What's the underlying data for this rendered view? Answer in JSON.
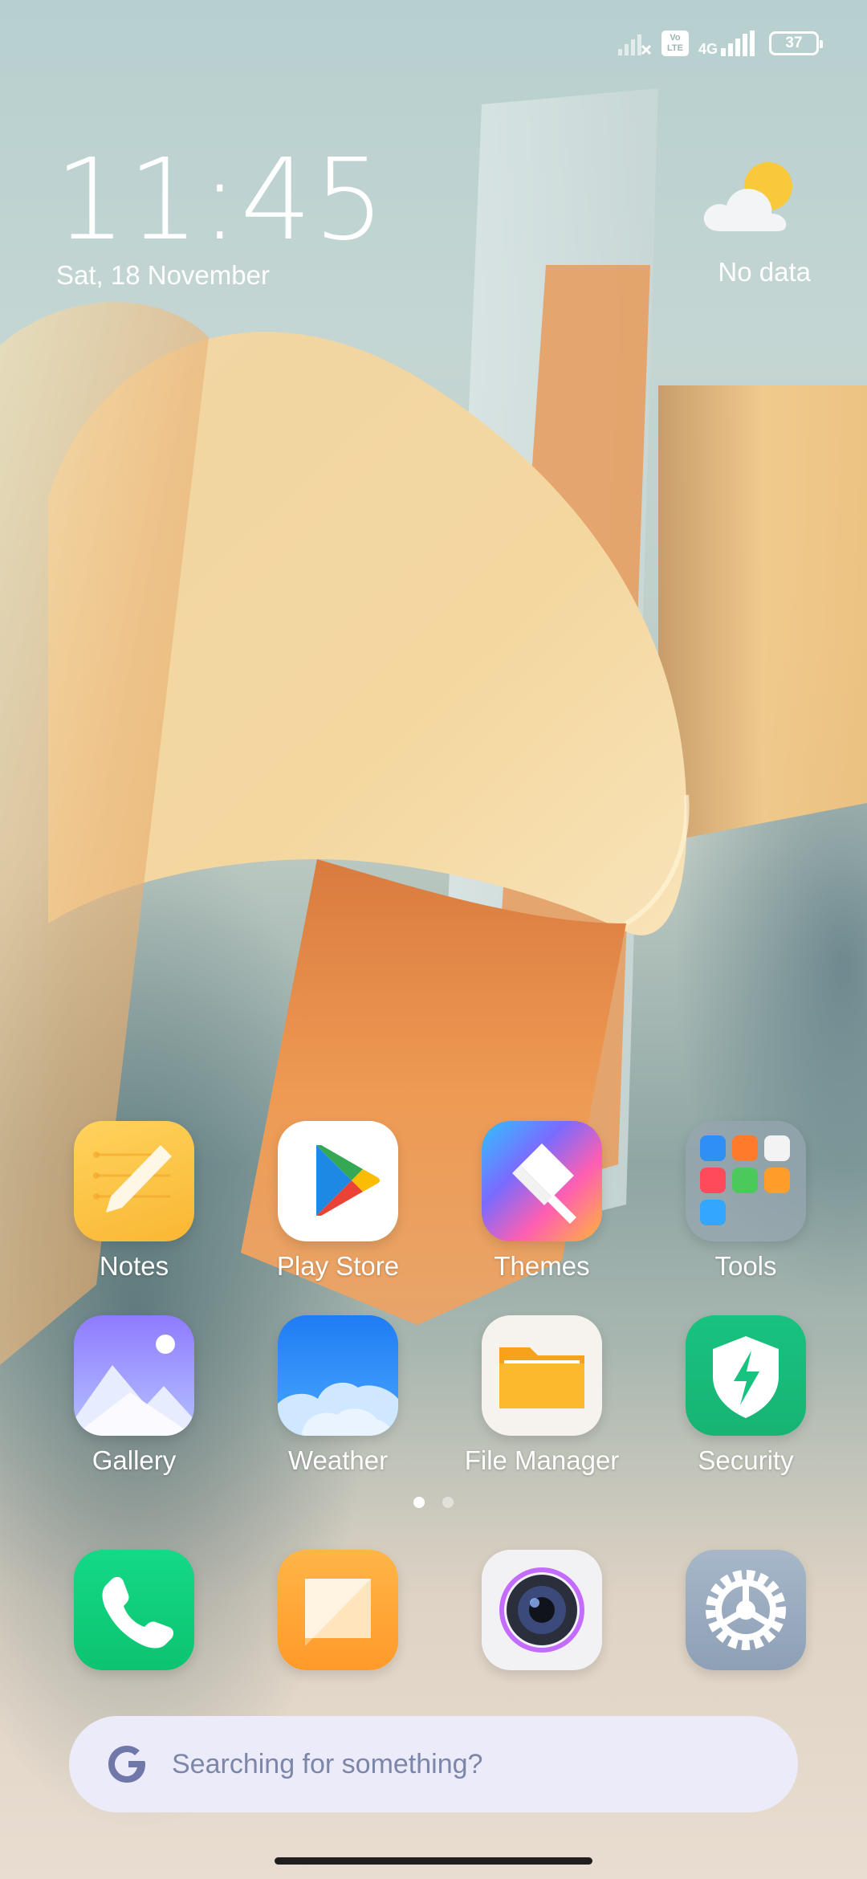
{
  "status_bar": {
    "battery": "37",
    "network": "4G",
    "volte": "Vo LTE",
    "icons": [
      "no-signal-sim1-icon",
      "volte-icon",
      "4g-icon",
      "signal-icon",
      "battery-icon"
    ]
  },
  "clock_widget": {
    "time": "11:45",
    "date": "Sat, 18 November"
  },
  "weather_widget": {
    "icon": "partly-cloudy-icon",
    "status": "No data"
  },
  "apps_row1": [
    {
      "label": "Notes",
      "icon": "notes-icon"
    },
    {
      "label": "Play Store",
      "icon": "play-store-icon"
    },
    {
      "label": "Themes",
      "icon": "themes-icon"
    },
    {
      "label": "Tools",
      "icon": "tools-folder-icon"
    }
  ],
  "apps_row2": [
    {
      "label": "Gallery",
      "icon": "gallery-icon"
    },
    {
      "label": "Weather",
      "icon": "weather-icon"
    },
    {
      "label": "File Manager",
      "icon": "file-manager-icon"
    },
    {
      "label": "Security",
      "icon": "security-icon"
    }
  ],
  "page_indicator": {
    "count": 2,
    "active": 1
  },
  "dock": [
    {
      "icon": "phone-icon"
    },
    {
      "icon": "messages-icon"
    },
    {
      "icon": "camera-icon"
    },
    {
      "icon": "settings-icon"
    }
  ],
  "search": {
    "placeholder": "Searching for something?",
    "icon": "google-g-icon"
  },
  "colors": {
    "notes": "#fcc244",
    "play_store_bg": "#ffffff",
    "weather": "#2e8cf5",
    "security": "#1fc384",
    "phone": "#10d27b",
    "messages": "#ffa339",
    "settings": "#9fb1c4",
    "search_bg": "#ecebfa"
  }
}
